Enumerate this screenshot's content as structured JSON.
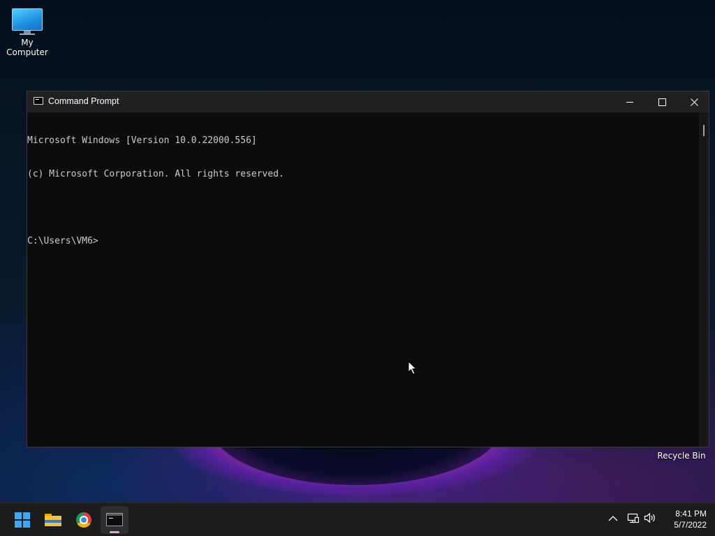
{
  "desktop": {
    "icons": [
      {
        "label": "My Computer",
        "icon": "monitor-icon"
      },
      {
        "label": "Recycle Bin",
        "icon": "recycle-bin-icon"
      }
    ]
  },
  "window": {
    "title": "Command Prompt",
    "icon": "cmd-icon",
    "controls": {
      "minimize": "minimize-icon",
      "maximize": "maximize-icon",
      "close": "close-icon"
    }
  },
  "console": {
    "lines": [
      "Microsoft Windows [Version 10.0.22000.556]",
      "(c) Microsoft Corporation. All rights reserved.",
      "",
      "C:\\Users\\VM6>"
    ]
  },
  "taskbar": {
    "apps": [
      {
        "name": "Start",
        "icon": "windows-start-icon"
      },
      {
        "name": "File Explorer",
        "icon": "folder-icon"
      },
      {
        "name": "Google Chrome",
        "icon": "chrome-icon"
      },
      {
        "name": "Command Prompt",
        "icon": "cmd-icon",
        "active": true
      }
    ],
    "tray": {
      "icons": [
        "chevron-up-icon",
        "network-icon",
        "volume-icon"
      ],
      "time": "8:41 PM",
      "date": "5/7/2022"
    }
  },
  "colors": {
    "console_bg": "#0c0c0c",
    "console_text": "#cccccc",
    "titlebar_bg": "#202020",
    "taskbar_bg": "#1c1c1c",
    "start_blue": "#3ea8f5",
    "active_indicator": "#e3a2cf"
  }
}
